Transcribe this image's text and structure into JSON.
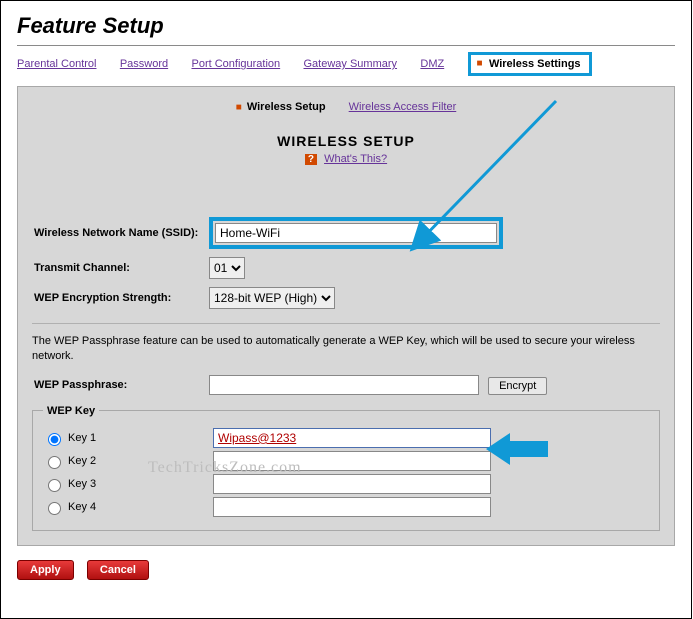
{
  "page_title": "Feature Setup",
  "top_tabs": {
    "parental": "Parental Control",
    "password": "Password",
    "portconf": "Port Configuration",
    "gwsummary": "Gateway Summary",
    "dmz": "DMZ",
    "wireless": "Wireless Settings"
  },
  "subtabs": {
    "setup": "Wireless Setup",
    "filter": "Wireless Access Filter"
  },
  "section_title": "WIRELESS SETUP",
  "whats_this": "What's This?",
  "labels": {
    "ssid": "Wireless Network Name (SSID):",
    "channel": "Transmit Channel:",
    "wep_strength": "WEP Encryption Strength:",
    "passphrase": "WEP Passphrase:",
    "keys_legend": "WEP Key",
    "key1": "Key 1",
    "key2": "Key 2",
    "key3": "Key 3",
    "key4": "Key 4"
  },
  "values": {
    "ssid": "Home-WiFi",
    "channel": "01",
    "wep_strength": "128-bit WEP (High)",
    "passphrase": "",
    "key1": "Wipass@1233",
    "key2": "",
    "key3": "",
    "key4": ""
  },
  "hint": "The WEP Passphrase feature can be used to automatically generate a WEP Key, which will be used to secure your wireless network.",
  "buttons": {
    "encrypt": "Encrypt",
    "apply": "Apply",
    "cancel": "Cancel"
  },
  "watermark": "TechTricksZone.com"
}
